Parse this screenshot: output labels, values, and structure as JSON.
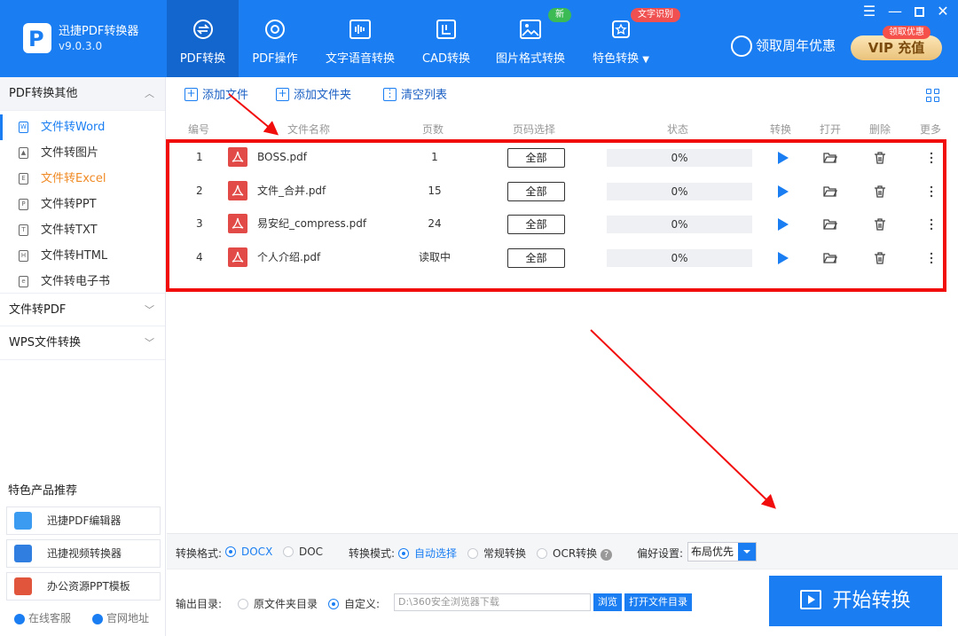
{
  "app": {
    "name": "迅捷PDF转换器",
    "version": "v9.0.3.0"
  },
  "nav": {
    "tabs": [
      {
        "label": "PDF转换",
        "icon": "exchange-icon",
        "active": true
      },
      {
        "label": "PDF操作",
        "icon": "settings-icon"
      },
      {
        "label": "文字语音转换",
        "icon": "voice-wave-icon"
      },
      {
        "label": "CAD转换",
        "icon": "cad-icon"
      },
      {
        "label": "图片格式转换",
        "icon": "image-icon"
      },
      {
        "label": "特色转换",
        "icon": "star-convert-icon"
      }
    ],
    "badge_new": "新",
    "badge_ocr": "文字识别",
    "promo": "领取周年优惠",
    "vip_label": "VIP 充值",
    "vip_tag": "领取优惠"
  },
  "sidebar": {
    "category_pdf_other": "PDF转换其他",
    "items": [
      {
        "label": "文件转Word",
        "icon": "word-icon",
        "glyph": "W"
      },
      {
        "label": "文件转图片",
        "icon": "picture-icon",
        "glyph": "▲"
      },
      {
        "label": "文件转Excel",
        "icon": "excel-icon",
        "glyph": "E"
      },
      {
        "label": "文件转PPT",
        "icon": "ppt-icon",
        "glyph": "P"
      },
      {
        "label": "文件转TXT",
        "icon": "txt-icon",
        "glyph": "T"
      },
      {
        "label": "文件转HTML",
        "icon": "html-icon",
        "glyph": "H"
      },
      {
        "label": "文件转电子书",
        "icon": "ebook-icon",
        "glyph": "e"
      }
    ],
    "category_to_pdf": "文件转PDF",
    "category_wps": "WPS文件转换",
    "recommend_title": "特色产品推荐",
    "recommend": [
      {
        "label": "迅捷PDF编辑器",
        "icon": "pdf-editor-icon"
      },
      {
        "label": "迅捷视频转换器",
        "icon": "video-converter-icon"
      },
      {
        "label": "办公资源PPT模板",
        "icon": "ppt-template-icon"
      }
    ],
    "footer_service": "在线客服",
    "footer_site": "官网地址"
  },
  "toolbar": {
    "add_file": "添加文件",
    "add_folder": "添加文件夹",
    "clear_list": "清空列表"
  },
  "table": {
    "headers": {
      "index": "编号",
      "name": "文件名称",
      "pages": "页数",
      "page_select": "页码选择",
      "status": "状态",
      "convert": "转换",
      "open": "打开",
      "delete": "删除",
      "more": "更多"
    },
    "rows": [
      {
        "index": "1",
        "name": "BOSS.pdf",
        "pages": "1",
        "page_select": "全部",
        "status": "0%"
      },
      {
        "index": "2",
        "name": "文件_合并.pdf",
        "pages": "15",
        "page_select": "全部",
        "status": "0%"
      },
      {
        "index": "3",
        "name": "易安纪_compress.pdf",
        "pages": "24",
        "page_select": "全部",
        "status": "0%"
      },
      {
        "index": "4",
        "name": "个人介绍.pdf",
        "pages": "读取中",
        "page_select": "全部",
        "status": "0%"
      }
    ]
  },
  "options": {
    "format_label": "转换格式:",
    "format_docx": "DOCX",
    "format_doc": "DOC",
    "mode_label": "转换模式:",
    "mode_auto": "自动选择",
    "mode_normal": "常规转换",
    "mode_ocr": "OCR转换",
    "pref_label": "偏好设置:",
    "pref_value": "布局优先"
  },
  "output": {
    "label": "输出目录:",
    "original": "原文件夹目录",
    "custom": "自定义:",
    "path": "D:\\360安全浏览器下载",
    "browse": "浏览",
    "open_dir": "打开文件目录"
  },
  "start_button": "开始转换",
  "colors": {
    "accent": "#1a7ef2",
    "header": "#1a7ef2",
    "annotation": "#f20d0d",
    "pdf_icon": "#e14a46"
  }
}
